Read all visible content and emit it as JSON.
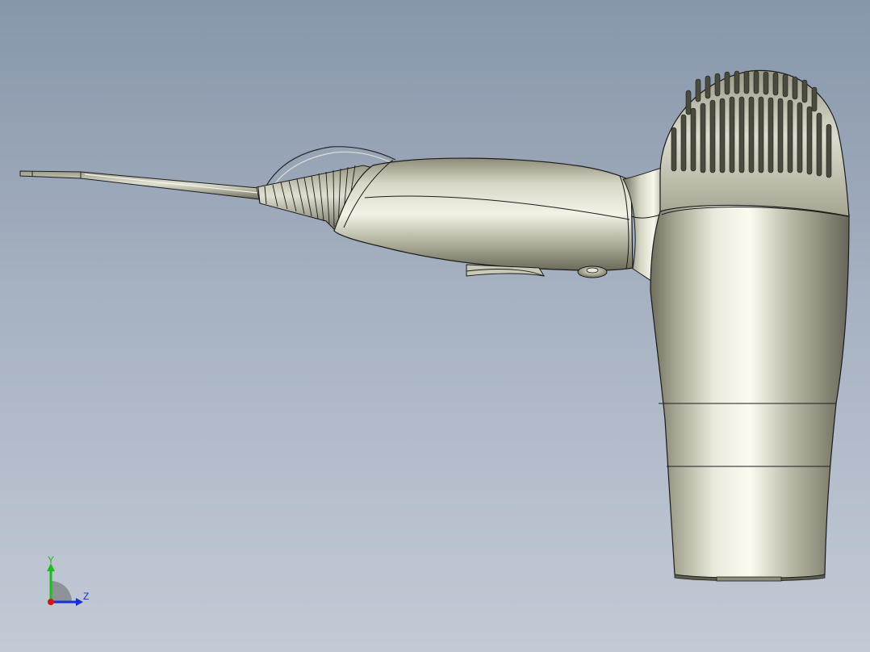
{
  "viewport": {
    "background_top": "#8796aa",
    "background_bottom": "#c3cad6"
  },
  "model": {
    "icon": "hair-dryer-3d-model",
    "surface_color": "#a9a995",
    "edge_color": "#1b1b1b"
  },
  "triad": {
    "y_label": "Y",
    "z_label": "Z",
    "y_color": "#18c018",
    "z_color": "#1a2fd0",
    "x_color": "#d01818"
  }
}
